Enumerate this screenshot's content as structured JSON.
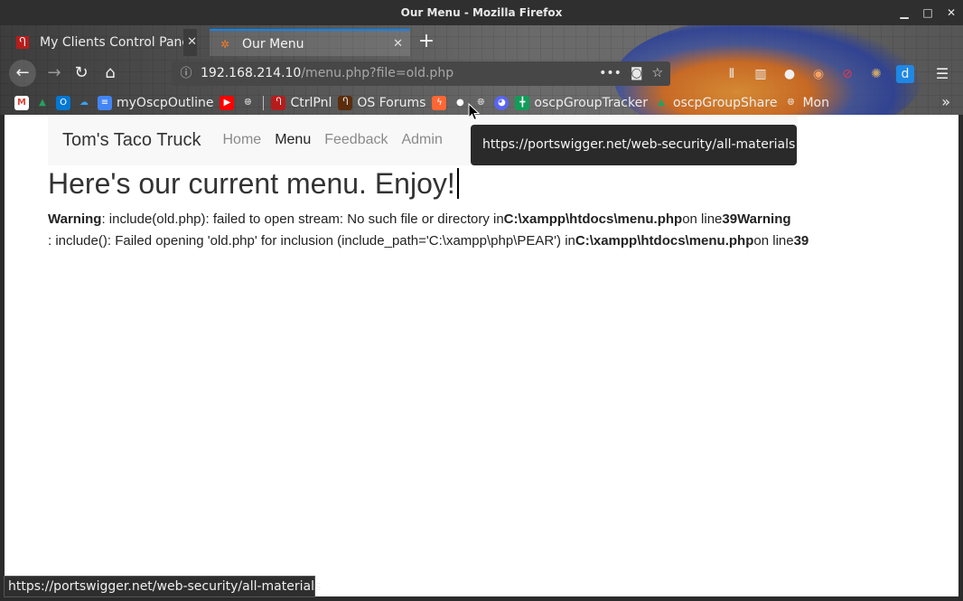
{
  "window": {
    "title": "Our Menu - Mozilla Firefox"
  },
  "tabs": [
    {
      "label": "My Clients Control Panel",
      "icon": "ctrlpnl-icon",
      "active": false
    },
    {
      "label": "Our Menu",
      "icon": "xampp-icon",
      "active": true
    }
  ],
  "address": {
    "host": "192.168.214.10",
    "path": "/menu.php?file=old.php"
  },
  "bookmarks": [
    {
      "label": "",
      "icon": "gmail-icon",
      "color": "#db4437"
    },
    {
      "label": "",
      "icon": "google-drive-icon",
      "color": "#1fa463"
    },
    {
      "label": "",
      "icon": "outlook-icon",
      "color": "#0078d4"
    },
    {
      "label": "",
      "icon": "onedrive-icon",
      "color": "#0364b8"
    },
    {
      "label": "myOscpOutline",
      "icon": "google-docs-icon",
      "color": "#4285f4"
    },
    {
      "label": "",
      "icon": "youtube-icon",
      "color": "#ff0000"
    },
    {
      "label": "",
      "icon": "globe-icon",
      "color": "#666666"
    },
    {
      "label": "CtrlPnl",
      "icon": "ctrlpnl-icon",
      "color": "#b71c1c"
    },
    {
      "label": "OS Forums",
      "icon": "offsec-icon",
      "color": "#5a2d0c"
    },
    {
      "label": "",
      "icon": "portswigger-icon",
      "color": "#ff6633"
    },
    {
      "label": "",
      "icon": "github-icon",
      "color": "#222222"
    },
    {
      "label": "",
      "icon": "globe-icon",
      "color": "#666666"
    },
    {
      "label": "",
      "icon": "discord-icon",
      "color": "#5865f2"
    },
    {
      "label": "oscpGroupTracker",
      "icon": "google-sheets-icon",
      "color": "#0f9d58"
    },
    {
      "label": "oscpGroupShare",
      "icon": "google-drive-icon",
      "color": "#1fa463"
    },
    {
      "label": "Mon",
      "icon": "globe-icon",
      "color": "#666666"
    }
  ],
  "site": {
    "brand": "Tom's Taco Truck",
    "nav": [
      "Home",
      "Menu",
      "Feedback",
      "Admin"
    ],
    "active_nav": "Menu",
    "heading": "Here's our current menu. Enjoy!",
    "warning_label": "Warning",
    "warning1": ": include(old.php): failed to open stream: No such file or directory in",
    "path": "C:\\xampp\\htdocs\\menu.php",
    "on_line": "on line",
    "line": "39",
    "warning2": ": include(): Failed opening 'old.php' for inclusion (include_path='C:\\xampp\\php\\PEAR') in"
  },
  "tooltip": "https://portswigger.net/web-security/all-materials",
  "status_url": "https://portswigger.net/web-security/all-materials"
}
